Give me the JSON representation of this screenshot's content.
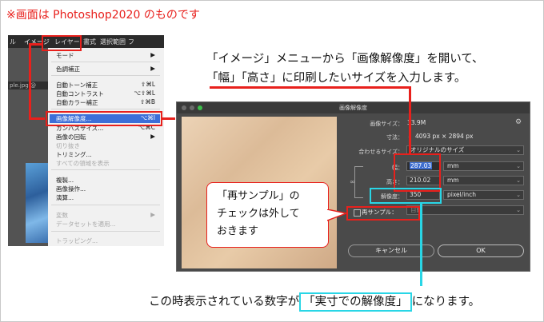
{
  "note": "※画面は Photoshop2020 のものです",
  "menubar": [
    "ル",
    "イメージ",
    "レイヤー",
    "書式",
    "選択範囲",
    "フ"
  ],
  "doc_tab": "ple.jpg @",
  "menu_items": [
    {
      "label": "モード",
      "shortcut": "▶",
      "disabled": false
    },
    {
      "label": "色調補正",
      "shortcut": "▶",
      "disabled": false
    },
    {
      "label": "自動トーン補正",
      "shortcut": "⇧⌘L",
      "disabled": false
    },
    {
      "label": "自動コントラスト",
      "shortcut": "⌥⇧⌘L",
      "disabled": false
    },
    {
      "label": "自動カラー補正",
      "shortcut": "⇧⌘B",
      "disabled": false
    },
    {
      "label": "画像解像度...",
      "shortcut": "⌥⌘I",
      "disabled": false,
      "highlighted": true
    },
    {
      "label": "カンバスサイズ...",
      "shortcut": "⌥⌘C",
      "disabled": false
    },
    {
      "label": "画像の回転",
      "shortcut": "▶",
      "disabled": false
    },
    {
      "label": "切り抜き",
      "shortcut": "",
      "disabled": true
    },
    {
      "label": "トリミング...",
      "shortcut": "",
      "disabled": false
    },
    {
      "label": "すべての領域を表示",
      "shortcut": "",
      "disabled": true
    },
    {
      "label": "複製...",
      "shortcut": "",
      "disabled": false
    },
    {
      "label": "画像操作...",
      "shortcut": "",
      "disabled": false
    },
    {
      "label": "演算...",
      "shortcut": "",
      "disabled": false
    },
    {
      "label": "変数",
      "shortcut": "▶",
      "disabled": true
    },
    {
      "label": "データセットを適用...",
      "shortcut": "",
      "disabled": true
    },
    {
      "label": "トラッピング...",
      "shortcut": "",
      "disabled": true
    }
  ],
  "instruction_line1": "「イメージ」メニューから「画像解像度」を開いて、",
  "instruction_line2": "「幅」「高さ」に印刷したいサイズを入力します。",
  "dialog": {
    "title": "画像解像度",
    "image_size_label": "画像サイズ：",
    "image_size_value": "33.9M",
    "dimensions_label": "寸法：",
    "dimensions_value": "4093 px × 2894 px",
    "fit_label": "合わせるサイズ：",
    "fit_value": "オリジナルのサイズ",
    "width_label": "幅：",
    "width_value": "287.03",
    "width_unit": "mm",
    "height_label": "高さ：",
    "height_value": "210.02",
    "height_unit": "mm",
    "resolution_label": "解像度：",
    "resolution_value": "350",
    "resolution_unit": "pixel/inch",
    "resample_label": "再サンプル：",
    "resample_value": "自動",
    "cancel": "キャンセル",
    "ok": "OK"
  },
  "callout_lines": [
    "「再サンプル」の",
    "チェックは外して",
    "おきます"
  ],
  "bottom_before": "この時表示されている数字が",
  "bottom_highlight": "「実寸での解像度」",
  "bottom_after": "になります。",
  "colors": {
    "red": "#e8201c",
    "cyan": "#29d6e6",
    "menu_highlight": "#3d6fd8"
  }
}
